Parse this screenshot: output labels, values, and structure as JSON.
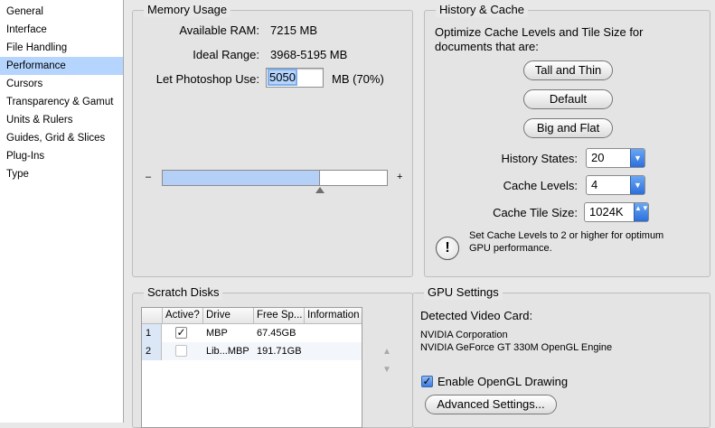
{
  "sidebar": {
    "items": [
      {
        "label": "General"
      },
      {
        "label": "Interface"
      },
      {
        "label": "File Handling"
      },
      {
        "label": "Performance",
        "selected": true
      },
      {
        "label": "Cursors"
      },
      {
        "label": "Transparency & Gamut"
      },
      {
        "label": "Units & Rulers"
      },
      {
        "label": "Guides, Grid & Slices"
      },
      {
        "label": "Plug-Ins"
      },
      {
        "label": "Type"
      }
    ]
  },
  "memory": {
    "title": "Memory Usage",
    "available_label": "Available RAM:",
    "available_value": "7215 MB",
    "ideal_label": "Ideal Range:",
    "ideal_value": "3968-5195 MB",
    "let_label": "Let Photoshop Use:",
    "let_value": "5050",
    "let_unit": "MB (70%)",
    "slider_min": "–",
    "slider_max": "+",
    "slider_fraction": 0.7
  },
  "history": {
    "title": "History & Cache",
    "optimize_line1": "Optimize Cache Levels and Tile Size for",
    "optimize_line2": "documents that are:",
    "btn_tall": "Tall and Thin",
    "btn_default": "Default",
    "btn_big": "Big and Flat",
    "states_label": "History States:",
    "states_value": "20",
    "levels_label": "Cache Levels:",
    "levels_value": "4",
    "tile_label": "Cache Tile Size:",
    "tile_value": "1024K",
    "note_line1": "Set Cache Levels to 2 or higher for optimum",
    "note_line2": "GPU performance."
  },
  "scratch": {
    "title": "Scratch Disks",
    "columns": [
      "Active?",
      "Drive",
      "Free Sp...",
      "Information"
    ],
    "rows": [
      {
        "num": "1",
        "active": true,
        "drive": "MBP",
        "free": "67.45GB",
        "info": ""
      },
      {
        "num": "2",
        "active": false,
        "drive": "Lib...MBP",
        "free": "191.71GB",
        "info": ""
      }
    ],
    "up_arrow": "▲",
    "down_arrow": "▼"
  },
  "gpu": {
    "title": "GPU Settings",
    "detected_label": "Detected Video Card:",
    "vendor": "NVIDIA Corporation",
    "card": "NVIDIA GeForce GT 330M OpenGL Engine",
    "enable_label": "Enable OpenGL Drawing",
    "enable_checked": true,
    "advanced_label": "Advanced Settings..."
  },
  "icons": {
    "check": "✓",
    "popup_arrow": "▼",
    "stepper": "▲▼",
    "warning": "!"
  }
}
